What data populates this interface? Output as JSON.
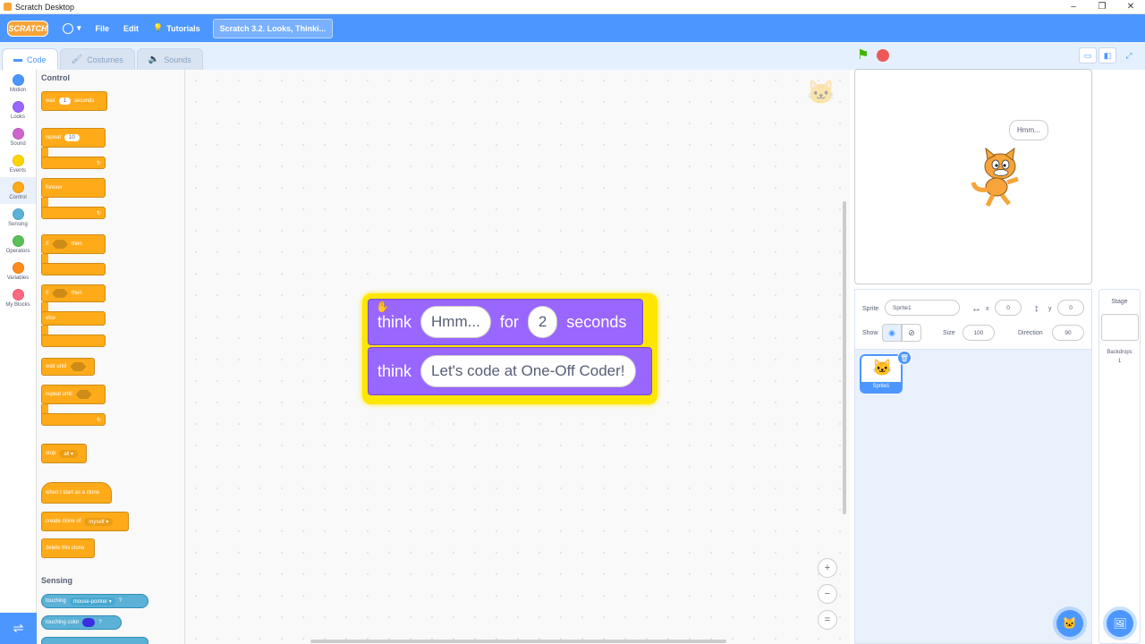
{
  "window": {
    "title": "Scratch Desktop",
    "controls": [
      "–",
      "❐",
      "✕"
    ]
  },
  "menubar": {
    "logo": "SCRATCH",
    "file": "File",
    "edit": "Edit",
    "tutorials": "Tutorials",
    "project_title": "Scratch 3.2. Looks, Thinki..."
  },
  "tabs": [
    {
      "label": "Code",
      "icon": "code-icon"
    },
    {
      "label": "Costumes",
      "icon": "brush-icon"
    },
    {
      "label": "Sounds",
      "icon": "speaker-icon"
    }
  ],
  "categories": [
    {
      "label": "Motion",
      "color": "#4c97ff"
    },
    {
      "label": "Looks",
      "color": "#9966ff"
    },
    {
      "label": "Sound",
      "color": "#cf63cf"
    },
    {
      "label": "Events",
      "color": "#ffd500"
    },
    {
      "label": "Control",
      "color": "#ffab19"
    },
    {
      "label": "Sensing",
      "color": "#5cb1d6"
    },
    {
      "label": "Operators",
      "color": "#59c059"
    },
    {
      "label": "Variables",
      "color": "#ff8c1a"
    },
    {
      "label": "My Blocks",
      "color": "#ff6680"
    }
  ],
  "palette": {
    "control_heading": "Control",
    "wait": {
      "label": "wait",
      "value": "1",
      "unit": "seconds"
    },
    "repeat": {
      "label": "repeat",
      "value": "10"
    },
    "forever": "forever",
    "if_then": {
      "if": "if",
      "then": "then"
    },
    "if_else": {
      "if": "if",
      "then": "then",
      "else": "else"
    },
    "wait_until": "wait until",
    "repeat_until": "repeat until",
    "stop": {
      "label": "stop",
      "option": "all"
    },
    "when_clone": "when I start as a clone",
    "create_clone": {
      "label": "create clone of",
      "option": "myself"
    },
    "delete_clone": "delete this clone",
    "sensing_heading": "Sensing",
    "touching": {
      "label": "touching",
      "option": "mouse-pointer",
      "q": "?"
    },
    "touching_color": {
      "label": "touching color",
      "q": "?"
    }
  },
  "script": {
    "block1": {
      "verb": "think",
      "message": "Hmm...",
      "for": "for",
      "secs": "2",
      "unit": "seconds"
    },
    "block2": {
      "verb": "think",
      "message": "Let's code at One-Off Coder!"
    }
  },
  "zoom": {
    "in": "+",
    "out": "−",
    "reset": "="
  },
  "stage": {
    "speech": "Hmm..."
  },
  "sprite_info": {
    "sprite_label": "Sprite",
    "sprite_name": "Sprite1",
    "x_label": "x",
    "x_value": "0",
    "y_label": "y",
    "y_value": "0",
    "show_label": "Show",
    "size_label": "Size",
    "size_value": "100",
    "direction_label": "Direction",
    "direction_value": "90",
    "thumb_name": "Sprite1"
  },
  "stage_pane": {
    "title": "Stage",
    "backdrops_label": "Backdrops",
    "backdrops_count": "1"
  }
}
